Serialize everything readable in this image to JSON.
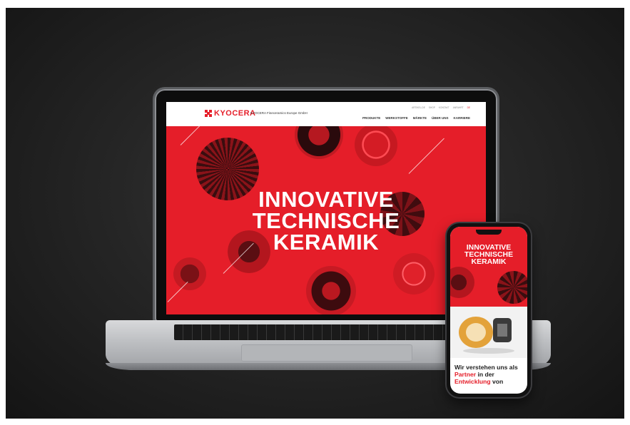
{
  "laptop_site": {
    "logo_text": "KYOCERA",
    "company_name": "KYOCERA Fineceramics Europe GmbH",
    "util_nav": [
      "ARTIKEL-DE",
      "SHOP",
      "KONTAKT",
      "ANFAHRT"
    ],
    "language": "DE",
    "main_nav": [
      "PRODUKTE",
      "WERKSTOFFE",
      "MÄRKTE",
      "ÜBER UNS",
      "KARRIERE"
    ],
    "hero_lines": [
      "INNOVATIVE",
      "TECHNISCHE",
      "KERAMIK"
    ]
  },
  "phone_site": {
    "hero_lines": [
      "INNOVATIVE",
      "TECHNISCHE",
      "KERAMIK"
    ],
    "body_text_1": "Wir verstehen uns als",
    "body_accent_1": "Partner",
    "body_text_2": " in der",
    "body_accent_2": "Entwicklung",
    "body_text_3": " von"
  },
  "colors": {
    "brand_red": "#e51e29",
    "background": "#1e1e1e"
  }
}
